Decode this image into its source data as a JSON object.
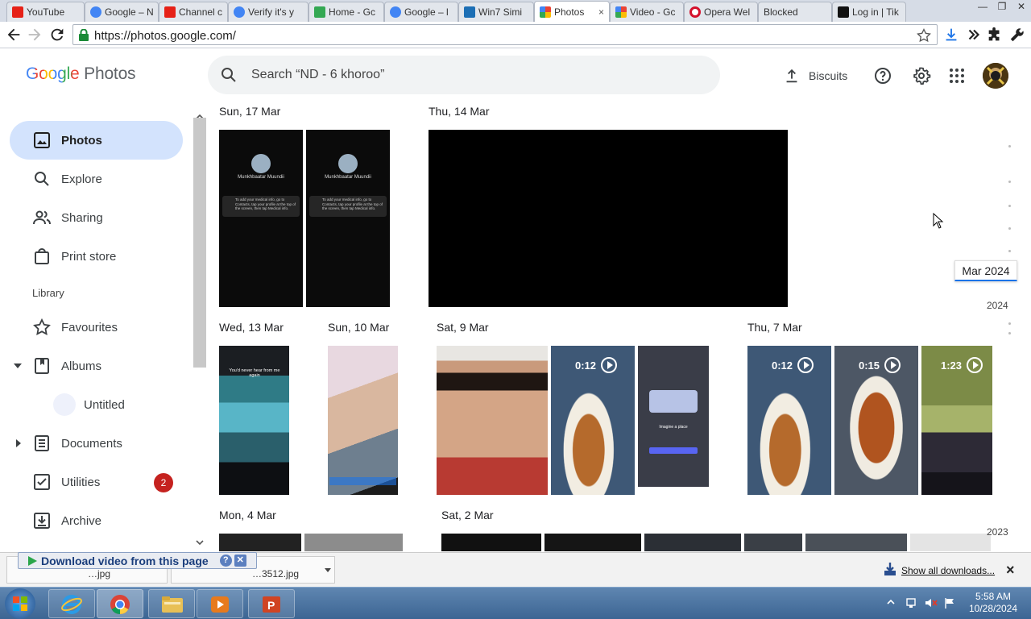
{
  "browser": {
    "tabs": [
      {
        "label": "YouTube",
        "favicon_color": "#e62117"
      },
      {
        "label": "Google – N",
        "favicon_color": "#4285f4"
      },
      {
        "label": "Channel c",
        "favicon_color": "#e62117"
      },
      {
        "label": "Verify it's y",
        "favicon_color": "#4285f4"
      },
      {
        "label": "Home - Gc",
        "favicon_color": "#34a853"
      },
      {
        "label": "Google – l",
        "favicon_color": "#4285f4"
      },
      {
        "label": "Win7 Simi",
        "favicon_color": "#1c6fb5"
      },
      {
        "label": "Photos",
        "favicon_color": "#fbbc04"
      },
      {
        "label": "Video - Gc",
        "favicon_color": "#fbbc04"
      },
      {
        "label": "Opera Wel",
        "favicon_color": "#d4112c"
      },
      {
        "label": "Blocked",
        "favicon_color": "#999999"
      },
      {
        "label": "Log in | Tik",
        "favicon_color": "#111111"
      }
    ],
    "active_tab_close": "×",
    "url": "https://photos.google.com/"
  },
  "app": {
    "logo_google": "Google",
    "logo_photos": "Photos",
    "search_placeholder": "Search “ND - 6 khoroo”",
    "upload_label": "Biscuits"
  },
  "sidebar": {
    "items": [
      {
        "label": "Photos",
        "icon": "photo-icon",
        "active": true
      },
      {
        "label": "Explore",
        "icon": "search-icon"
      },
      {
        "label": "Sharing",
        "icon": "people-icon"
      },
      {
        "label": "Print store",
        "icon": "shopping-bag-icon"
      }
    ],
    "library_header": "Library",
    "library": [
      {
        "label": "Favourites",
        "icon": "star-icon"
      },
      {
        "label": "Albums",
        "icon": "album-icon"
      },
      {
        "label": "Untitled",
        "icon": "album-thumb"
      },
      {
        "label": "Documents",
        "icon": "document-icon"
      },
      {
        "label": "Utilities",
        "icon": "checklist-icon",
        "badge": "2"
      },
      {
        "label": "Archive",
        "icon": "archive-icon"
      }
    ]
  },
  "timeline": {
    "dates": [
      "Sun, 17 Mar",
      "Thu, 14 Mar",
      "Wed, 13 Mar",
      "Sun, 10 Mar",
      "Sat, 9 Mar",
      "Thu, 7 Mar",
      "Mon, 4 Mar",
      "Sat, 2 Mar"
    ],
    "durations": [
      "0:12",
      "0:12",
      "0:15",
      "1:23"
    ],
    "screenshot_name": "Munkhbaatar Muundii",
    "screenshot_text": "To add your medical info, go to Contacts, tap your profile at the top of the screen, then tap Medical info.",
    "story_caption": "You'd never hear from me again",
    "discord_title": "Imagine a place"
  },
  "scrubber": {
    "tooltip": "Mar 2024",
    "years": [
      "2024",
      "2023"
    ]
  },
  "downloads": {
    "popup_label": "Download video from this page",
    "file1": "…jpg",
    "file2": "…3512.jpg",
    "show_all": "Show all downloads...",
    "close": "×"
  },
  "taskbar": {
    "time": "5:58 AM",
    "date": "10/28/2024"
  }
}
